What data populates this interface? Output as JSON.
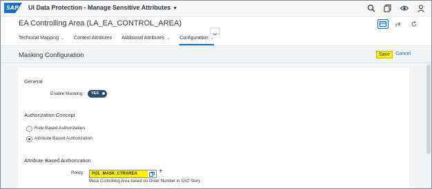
{
  "shell": {
    "logo_text": "SAP",
    "app_title": "UI Data Protection - Manage Sensitive Attributes",
    "icons": [
      "search-icon",
      "copy-icon",
      "eye-icon",
      "user-icon"
    ]
  },
  "header": {
    "title": "EA Controlling Area (LA_EA_CONTROL_AREA)",
    "actions": [
      "display-icon",
      "share-icon",
      "refresh-icon"
    ]
  },
  "tabs": [
    {
      "label": "Technical Mapping",
      "selected": false
    },
    {
      "label": "Context Attributes",
      "selected": false
    },
    {
      "label": "Additional Attributes",
      "selected": false
    },
    {
      "label": "Configuration",
      "selected": true
    }
  ],
  "section": {
    "title": "Masking Configuration",
    "save_label": "Save",
    "cancel_label": "Cancel"
  },
  "general": {
    "title": "General",
    "enable_masking_label": "Enable Masking:",
    "toggle_text": "YES",
    "enabled": true
  },
  "authorization": {
    "title": "Authorization Concept",
    "options": [
      {
        "label": "Role Based Authorization",
        "selected": false
      },
      {
        "label": "Attribute Based Authorization",
        "selected": true
      }
    ]
  },
  "abac": {
    "title": "Attribute Based Authorization",
    "policy_label": "Policy:",
    "policy_value": "POL_MASK_CTRAREA",
    "policy_description": "Mask Controlling Area based on Order Number in SAC Story"
  },
  "colors": {
    "highlight": "#fff200",
    "accent": "#0a6ed1",
    "toggle": "#2b4c6f"
  }
}
